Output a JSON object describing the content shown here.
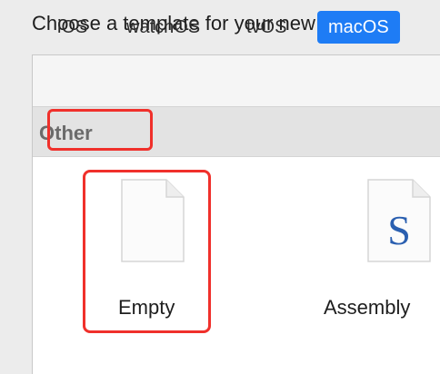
{
  "prompt": "Choose a template for your new file:",
  "tabs": [
    {
      "label": "iOS",
      "active": false
    },
    {
      "label": "watchOS",
      "active": false
    },
    {
      "label": "tvOS",
      "active": false
    },
    {
      "label": "macOS",
      "active": true
    }
  ],
  "section": {
    "title": "Other"
  },
  "templates": [
    {
      "name": "Empty",
      "icon": "blank-document-icon",
      "selected": true
    },
    {
      "name": "Assembly",
      "icon": "assembly-document-icon",
      "glyph": "S",
      "selected": false
    }
  ],
  "colors": {
    "accent": "#1e7cf5",
    "highlight": "#f0302b",
    "assembly_glyph": "#2a5fb0"
  }
}
